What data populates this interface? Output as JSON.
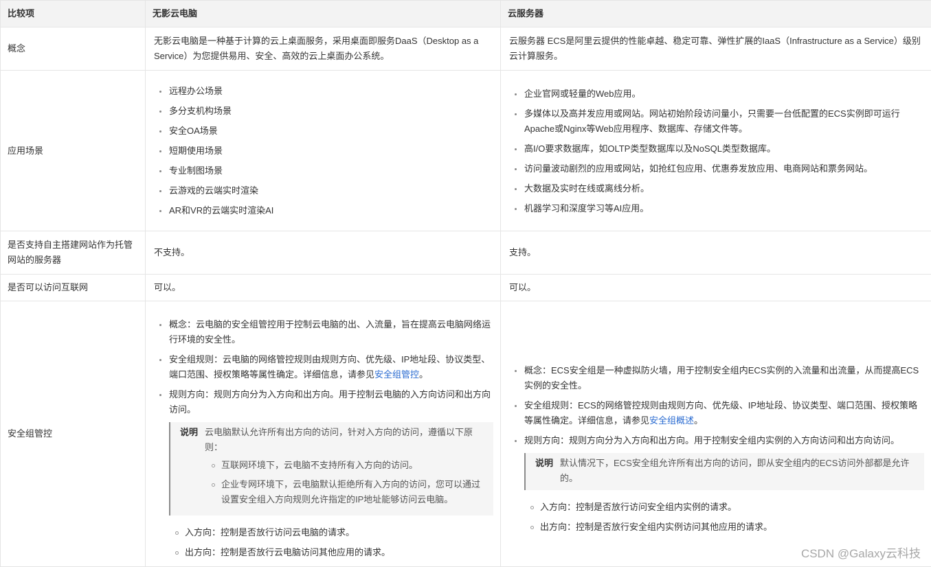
{
  "headers": [
    "比较项",
    "无影云电脑",
    "云服务器"
  ],
  "rows": {
    "concept": {
      "label": "概念",
      "wuying": "无影云电脑是一种基于计算的云上桌面服务，采用桌面即服务DaaS（Desktop as a Service）为您提供易用、安全、高效的云上桌面办公系统。",
      "ecs": "云服务器 ECS是阿里云提供的性能卓越、稳定可靠、弹性扩展的IaaS（Infrastructure as a Service）级别云计算服务。"
    },
    "scenarios": {
      "label": "应用场景",
      "wuying": [
        "远程办公场景",
        "多分支机构场景",
        "安全OA场景",
        "短期使用场景",
        "专业制图场景",
        "云游戏的云端实时渲染",
        "AR和VR的云端实时渲染AI"
      ],
      "ecs": [
        "企业官网或轻量的Web应用。",
        "多媒体以及高并发应用或网站。网站初始阶段访问量小，只需要一台低配置的ECS实例即可运行Apache或Nginx等Web应用程序、数据库、存储文件等。",
        "高I/O要求数据库，如OLTP类型数据库以及NoSQL类型数据库。",
        "访问量波动剧烈的应用或网站，如抢红包应用、优惠券发放应用、电商网站和票务网站。",
        "大数据及实时在线或离线分析。",
        "机器学习和深度学习等AI应用。"
      ]
    },
    "hosting": {
      "label": "是否支持自主搭建网站作为托管网站的服务器",
      "wuying": "不支持。",
      "ecs": "支持。"
    },
    "internet": {
      "label": "是否可以访问互联网",
      "wuying": "可以。",
      "ecs": "可以。"
    },
    "security": {
      "label": "安全组管控",
      "wuying": {
        "concept": "概念：云电脑的安全组管控用于控制云电脑的出、入流量，旨在提高云电脑网络运行环境的安全性。",
        "rules_prefix": "安全组规则：云电脑的网络管控规则由规则方向、优先级、IP地址段、协议类型、端口范围、授权策略等属性确定。详细信息，请参见",
        "rules_link": "安全组管控",
        "rules_suffix": "。",
        "direction": "规则方向：规则方向分为入方向和出方向。用于控制云电脑的入方向访问和出方向访问。",
        "note_label": "说明",
        "note_text": "云电脑默认允许所有出方向的访问，针对入方向的访问，遵循以下原则：",
        "note_items": [
          "互联网环境下，云电脑不支持所有入方向的访问。",
          "企业专网环境下，云电脑默认拒绝所有入方向的访问，您可以通过设置安全组入方向规则允许指定的IP地址能够访问云电脑。"
        ],
        "sub_items": [
          "入方向：控制是否放行访问云电脑的请求。",
          "出方向：控制是否放行云电脑访问其他应用的请求。"
        ]
      },
      "ecs": {
        "concept": "概念：ECS安全组是一种虚拟防火墙，用于控制安全组内ECS实例的入流量和出流量，从而提高ECS实例的安全性。",
        "rules_prefix": "安全组规则：ECS的网络管控规则由规则方向、优先级、IP地址段、协议类型、端口范围、授权策略等属性确定。详细信息，请参见",
        "rules_link": "安全组概述",
        "rules_suffix": "。",
        "direction": "规则方向：规则方向分为入方向和出方向。用于控制安全组内实例的入方向访问和出方向访问。",
        "note_label": "说明",
        "note_text": "默认情况下，ECS安全组允许所有出方向的访问，即从安全组内的ECS访问外部都是允许的。",
        "sub_items": [
          "入方向：控制是否放行访问安全组内实例的请求。",
          "出方向：控制是否放行安全组内实例访问其他应用的请求。"
        ]
      }
    }
  },
  "watermark": "CSDN @Galaxy云科技",
  "colors": {
    "header_bg": "#f3f3f3",
    "border": "#e5e5e5",
    "link": "#2b6cd1",
    "note_bg": "#f5f5f5"
  }
}
